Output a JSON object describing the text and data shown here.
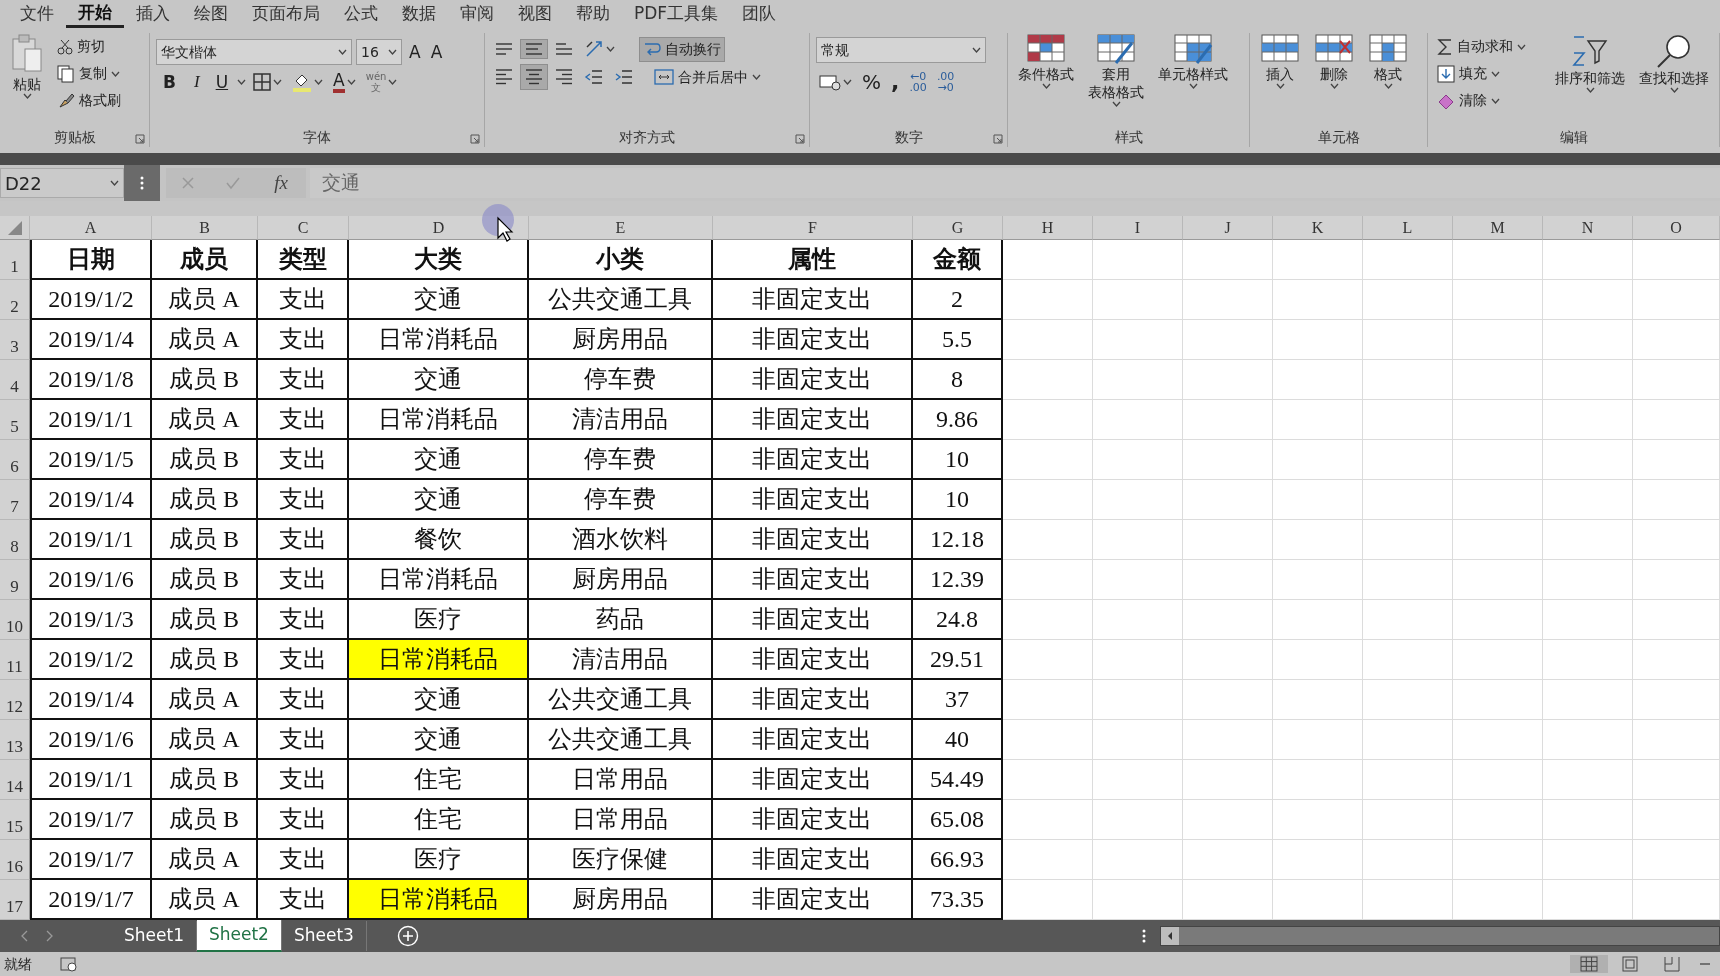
{
  "menu_tabs": [
    {
      "label": "文件",
      "selected": false
    },
    {
      "label": "开始",
      "selected": true
    },
    {
      "label": "插入",
      "selected": false
    },
    {
      "label": "绘图",
      "selected": false
    },
    {
      "label": "页面布局",
      "selected": false
    },
    {
      "label": "公式",
      "selected": false
    },
    {
      "label": "数据",
      "selected": false
    },
    {
      "label": "审阅",
      "selected": false
    },
    {
      "label": "视图",
      "selected": false
    },
    {
      "label": "帮助",
      "selected": false
    },
    {
      "label": "PDF工具集",
      "selected": false
    },
    {
      "label": "团队",
      "selected": false
    }
  ],
  "ribbon": {
    "clipboard": {
      "title": "剪贴板",
      "paste": "粘贴",
      "cut": "剪切",
      "copy": "复制",
      "format_painter": "格式刷"
    },
    "font": {
      "title": "字体",
      "font_name": "华文楷体",
      "font_size": "16",
      "grow": "A",
      "shrink": "A",
      "bold": "B",
      "italic": "I",
      "underline": "U",
      "font_color": "A",
      "phonetic_top": "wén",
      "phonetic_bottom": "文"
    },
    "alignment": {
      "title": "对齐方式",
      "vertical_align": [
        {
          "selected": false
        },
        {
          "selected": true
        },
        {
          "selected": false
        }
      ],
      "horizontal_align": [
        {
          "selected": false
        },
        {
          "selected": true
        },
        {
          "selected": false
        }
      ],
      "wrap_text": {
        "label": "自动换行",
        "selected": true
      },
      "merge_center": "合并后居中"
    },
    "number": {
      "title": "数字",
      "format": "常规",
      "percent": "%",
      "comma": ",",
      "increase_decimal": [
        "←0",
        ".00"
      ],
      "decrease_decimal": [
        ".00",
        "→0"
      ]
    },
    "styles": {
      "title": "样式",
      "conditional": "条件格式",
      "table_format": [
        "套用",
        "表格格式"
      ],
      "cell_styles": "单元格样式"
    },
    "cells": {
      "title": "单元格",
      "insert": "插入",
      "delete": "删除",
      "format": "格式"
    },
    "editing": {
      "title": "编辑",
      "autosum": "自动求和",
      "fill": "填充",
      "clear": "清除",
      "sort_filter": "排序和筛选",
      "find_select": "查找和选择"
    }
  },
  "formula_bar": {
    "name_box": "D22",
    "fx": "fx",
    "formula": "交通"
  },
  "columns": [
    "A",
    "B",
    "C",
    "D",
    "E",
    "F",
    "G",
    "H",
    "I",
    "J",
    "K",
    "L",
    "M",
    "N",
    "O"
  ],
  "rows": [
    {
      "number": "1",
      "kind": "header",
      "highlighted": [
        false,
        false,
        false,
        false,
        false,
        false,
        false
      ],
      "cells": [
        "日期",
        "成员",
        "类型",
        "大类",
        "小类",
        "属性",
        "金额"
      ]
    },
    {
      "number": "2",
      "kind": "data",
      "cells": [
        "2019/1/2",
        "成员 A",
        "支出",
        "交通",
        "公共交通工具",
        "非固定支出",
        "2"
      ]
    },
    {
      "number": "3",
      "kind": "data",
      "cells": [
        "2019/1/4",
        "成员 A",
        "支出",
        "日常消耗品",
        "厨房用品",
        "非固定支出",
        "5.5"
      ]
    },
    {
      "number": "4",
      "kind": "data",
      "cells": [
        "2019/1/8",
        "成员 B",
        "支出",
        "交通",
        "停车费",
        "非固定支出",
        "8"
      ]
    },
    {
      "number": "5",
      "kind": "data",
      "cells": [
        "2019/1/1",
        "成员 A",
        "支出",
        "日常消耗品",
        "清洁用品",
        "非固定支出",
        "9.86"
      ]
    },
    {
      "number": "6",
      "kind": "data",
      "cells": [
        "2019/1/5",
        "成员 B",
        "支出",
        "交通",
        "停车费",
        "非固定支出",
        "10"
      ]
    },
    {
      "number": "7",
      "kind": "data",
      "cells": [
        "2019/1/4",
        "成员 B",
        "支出",
        "交通",
        "停车费",
        "非固定支出",
        "10"
      ]
    },
    {
      "number": "8",
      "kind": "data",
      "cells": [
        "2019/1/1",
        "成员 B",
        "支出",
        "餐饮",
        "酒水饮料",
        "非固定支出",
        "12.18"
      ]
    },
    {
      "number": "9",
      "kind": "data",
      "cells": [
        "2019/1/6",
        "成员 B",
        "支出",
        "日常消耗品",
        "厨房用品",
        "非固定支出",
        "12.39"
      ]
    },
    {
      "number": "10",
      "kind": "data",
      "cells": [
        "2019/1/3",
        "成员 B",
        "支出",
        "医疗",
        "药品",
        "非固定支出",
        "24.8"
      ]
    },
    {
      "number": "11",
      "kind": "data",
      "highlighted": [
        false,
        false,
        false,
        true,
        false,
        false,
        false
      ],
      "cells": [
        "2019/1/2",
        "成员 B",
        "支出",
        "日常消耗品",
        "清洁用品",
        "非固定支出",
        "29.51"
      ]
    },
    {
      "number": "12",
      "kind": "data",
      "cells": [
        "2019/1/4",
        "成员 A",
        "支出",
        "交通",
        "公共交通工具",
        "非固定支出",
        "37"
      ]
    },
    {
      "number": "13",
      "kind": "data",
      "cells": [
        "2019/1/6",
        "成员 A",
        "支出",
        "交通",
        "公共交通工具",
        "非固定支出",
        "40"
      ]
    },
    {
      "number": "14",
      "kind": "data",
      "cells": [
        "2019/1/1",
        "成员 B",
        "支出",
        "住宅",
        "日常用品",
        "非固定支出",
        "54.49"
      ]
    },
    {
      "number": "15",
      "kind": "data",
      "cells": [
        "2019/1/7",
        "成员 B",
        "支出",
        "住宅",
        "日常用品",
        "非固定支出",
        "65.08"
      ]
    },
    {
      "number": "16",
      "kind": "data",
      "cells": [
        "2019/1/7",
        "成员 A",
        "支出",
        "医疗",
        "医疗保健",
        "非固定支出",
        "66.93"
      ]
    },
    {
      "number": "17",
      "kind": "data",
      "highlighted": [
        false,
        false,
        false,
        true,
        false,
        false,
        false
      ],
      "cells": [
        "2019/1/7",
        "成员 A",
        "支出",
        "日常消耗品",
        "厨房用品",
        "非固定支出",
        "73.35"
      ]
    }
  ],
  "sheet_tabs": [
    {
      "label": "Sheet1",
      "selected": false
    },
    {
      "label": "Sheet2",
      "selected": true
    },
    {
      "label": "Sheet3",
      "selected": false
    }
  ],
  "status": "就绪"
}
